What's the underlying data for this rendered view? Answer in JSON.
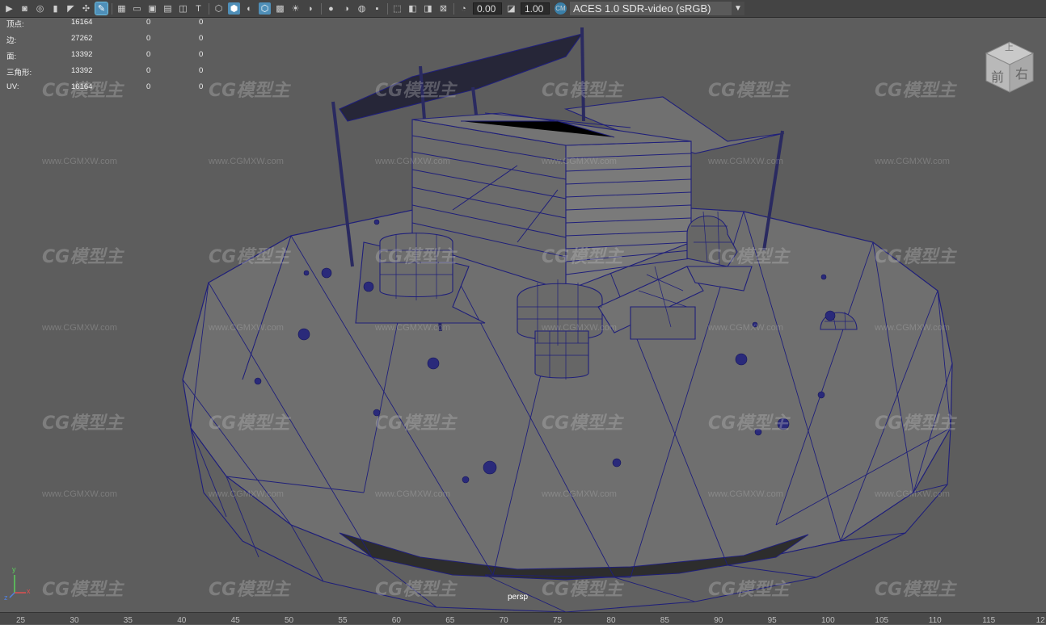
{
  "toolbar": {
    "icons": [
      "camera-icon",
      "camera-attr-icon",
      "bookmark-icon",
      "image-plane-icon",
      "grid-icon",
      "wireframe-shade-icon",
      "smooth-shade-icon",
      "textured-icon",
      "lights-icon",
      "shadows-icon",
      "isolate-icon",
      "xray-icon",
      "resolution-gate-icon",
      "exposure-icon",
      "gamma-icon",
      "color-manage-icon"
    ],
    "exposure_value": "0.00",
    "gamma_value": "1.00",
    "color_space": "ACES 1.0 SDR-video (sRGB)"
  },
  "hud": {
    "rows": [
      {
        "label": "顶点:",
        "total": "16164",
        "selected": "0",
        "component": "0"
      },
      {
        "label": "边:",
        "total": "27262",
        "selected": "0",
        "component": "0"
      },
      {
        "label": "面:",
        "total": "13392",
        "selected": "0",
        "component": "0"
      },
      {
        "label": "三角形:",
        "total": "13392",
        "selected": "0",
        "component": "0"
      },
      {
        "label": "UV:",
        "total": "16164",
        "selected": "0",
        "component": "0"
      }
    ]
  },
  "viewcube": {
    "top": "上",
    "front": "前",
    "right": "右"
  },
  "camera_label": "persp",
  "axis": {
    "x": "x",
    "y": "y",
    "z": "z"
  },
  "watermark": {
    "logo": "CG模型主",
    "url": "www.CGMXW.com"
  },
  "timeline": {
    "ticks": [
      "25",
      "30",
      "35",
      "40",
      "45",
      "50",
      "55",
      "60",
      "65",
      "70",
      "75",
      "80",
      "85",
      "90",
      "95",
      "100",
      "105",
      "110",
      "115",
      "12"
    ]
  },
  "colors": {
    "viewport_bg": "#5d5d5d",
    "wire": "#1f1f7a",
    "surface": "#6e6e6e",
    "toolbar_bg": "#444444"
  }
}
